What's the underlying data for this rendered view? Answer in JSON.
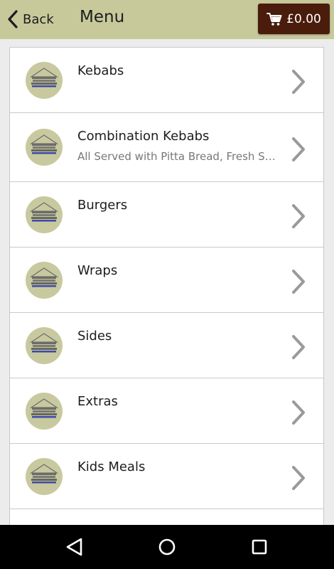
{
  "header": {
    "back_label": "Back",
    "title": "Menu",
    "cart_total": "£0.00"
  },
  "menu": {
    "items": [
      {
        "title": "Kebabs",
        "subtitle": ""
      },
      {
        "title": "Combination Kebabs",
        "subtitle": "All Served with Pitta Bread, Fresh Salad and Sauce"
      },
      {
        "title": "Burgers",
        "subtitle": ""
      },
      {
        "title": "Wraps",
        "subtitle": ""
      },
      {
        "title": "Sides",
        "subtitle": ""
      },
      {
        "title": "Extras",
        "subtitle": ""
      },
      {
        "title": "Kids Meals",
        "subtitle": ""
      },
      {
        "title": "",
        "subtitle": ""
      }
    ]
  },
  "icons": {
    "back": "chevron-left-icon",
    "cart": "shopping-cart-icon",
    "row_arrow": "chevron-right-icon",
    "thumbnail": "restaurant-logo",
    "nav_back": "triangle-back-icon",
    "nav_home": "circle-home-icon",
    "nav_recents": "square-recents-icon"
  },
  "colors": {
    "header_bg": "#c7c99b",
    "cart_button_bg": "#4a1c0c",
    "page_bg": "#ececec",
    "row_bg": "#ffffff",
    "chevron": "#9a9a9a",
    "nav_bar_bg": "#000000"
  }
}
